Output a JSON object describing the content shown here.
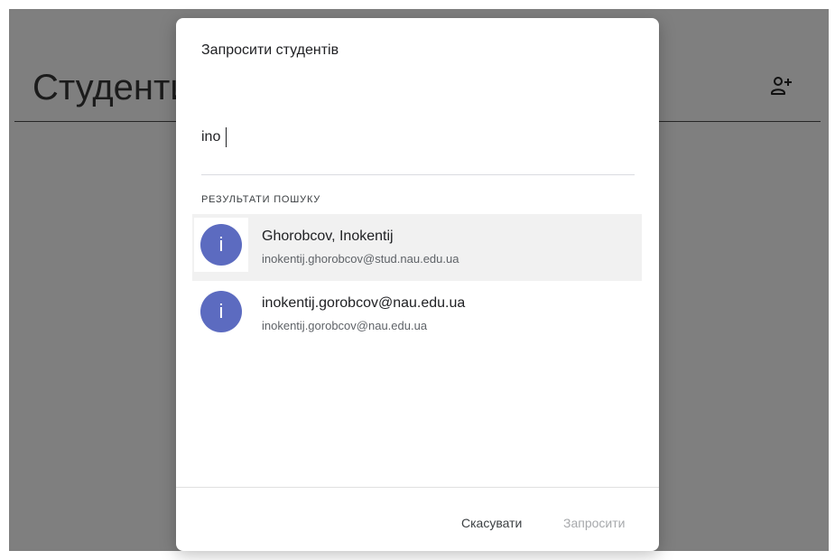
{
  "page": {
    "title": "Студенти"
  },
  "header": {
    "add_icon": "person-add-icon"
  },
  "dialog": {
    "title": "Запросити студентів",
    "search": {
      "value": "ino",
      "placeholder": ""
    },
    "results_heading": "РЕЗУЛЬТАТИ ПОШУКУ",
    "results": [
      {
        "avatar_letter": "i",
        "name": "Ghorobcov, Inokentij",
        "email": "inokentij.ghorobcov@stud.nau.edu.ua",
        "highlighted": true
      },
      {
        "avatar_letter": "i",
        "name": "inokentij.gorobcov@nau.edu.ua",
        "email": "inokentij.gorobcov@nau.edu.ua",
        "highlighted": false
      }
    ],
    "cancel_label": "Скасувати",
    "invite_label": "Запросити"
  },
  "colors": {
    "avatar": "#5c6bc0",
    "backdrop": "#7f7f7f",
    "highlight": "#f1f1f1",
    "disabled_text": "#a7a9ac"
  }
}
